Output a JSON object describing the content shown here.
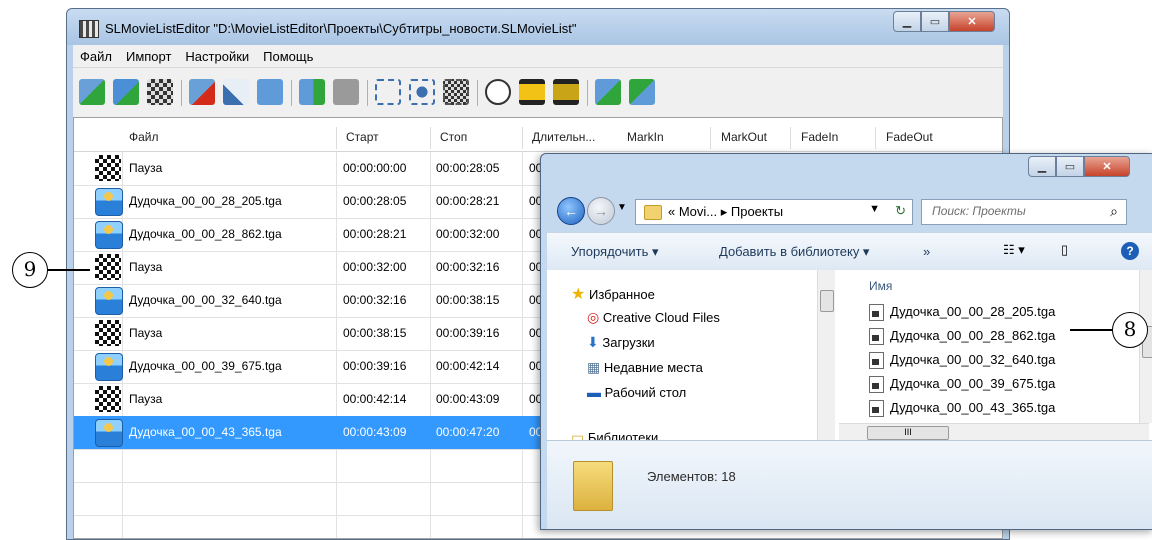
{
  "editor": {
    "title": "SLMovieListEditor \"D:\\MovieListEditor\\Проекты\\Субтитры_новости.SLMovieList\"",
    "menu": [
      "Файл",
      "Импорт",
      "Настройки",
      "Помощь"
    ],
    "columns": [
      "Файл",
      "Старт",
      "Стоп",
      "Длительн...",
      "MarkIn",
      "MarkOut",
      "FadeIn",
      "FadeOut"
    ],
    "rows": [
      {
        "name": "Пауза",
        "start": "00:00:00:00",
        "stop": "00:00:28:05",
        "dur": "00",
        "icon": "checker-icon"
      },
      {
        "name": "Дудочка_00_00_28_205.tga",
        "start": "00:00:28:05",
        "stop": "00:00:28:21",
        "dur": "00",
        "icon": "image-icon"
      },
      {
        "name": "Дудочка_00_00_28_862.tga",
        "start": "00:00:28:21",
        "stop": "00:00:32:00",
        "dur": "00",
        "icon": "image-icon"
      },
      {
        "name": "Пауза",
        "start": "00:00:32:00",
        "stop": "00:00:32:16",
        "dur": "00",
        "icon": "checker-icon"
      },
      {
        "name": "Дудочка_00_00_32_640.tga",
        "start": "00:00:32:16",
        "stop": "00:00:38:15",
        "dur": "00",
        "icon": "image-icon"
      },
      {
        "name": "Пауза",
        "start": "00:00:38:15",
        "stop": "00:00:39:16",
        "dur": "00",
        "icon": "checker-icon"
      },
      {
        "name": "Дудочка_00_00_39_675.tga",
        "start": "00:00:39:16",
        "stop": "00:00:42:14",
        "dur": "00",
        "icon": "image-icon"
      },
      {
        "name": "Пауза",
        "start": "00:00:42:14",
        "stop": "00:00:43:09",
        "dur": "00",
        "icon": "checker-icon"
      },
      {
        "name": "Дудочка_00_00_43_365.tga",
        "start": "00:00:43:09",
        "stop": "00:00:47:20",
        "dur": "00",
        "icon": "image-icon",
        "selected": true
      }
    ]
  },
  "explorer": {
    "address": "« Movi... ▸ Проекты",
    "search_placeholder": "Поиск: Проекты",
    "commands": {
      "organize": "Упорядочить ▾",
      "add_library": "Добавить в библиотеку ▾",
      "more": "»"
    },
    "nav": {
      "favorites": "Избранное",
      "creative_cloud": "Creative Cloud Files",
      "downloads": "Загрузки",
      "recent": "Недавние места",
      "desktop": "Рабочий стол",
      "libraries": "Библиотеки"
    },
    "column_name": "Имя",
    "files": [
      "Дудочка_00_00_28_205.tga",
      "Дудочка_00_00_28_862.tga",
      "Дудочка_00_00_32_640.tga",
      "Дудочка_00_00_39_675.tga",
      "Дудочка_00_00_43_365.tga"
    ],
    "status": "Элементов: 18"
  },
  "callouts": {
    "left": "9",
    "right": "8"
  }
}
